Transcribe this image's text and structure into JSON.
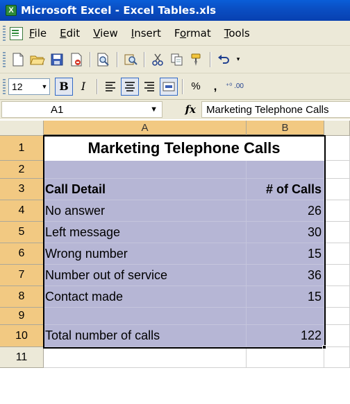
{
  "window": {
    "title": "Microsoft Excel - Excel Tables.xls"
  },
  "menu": [
    {
      "pre": "",
      "ul": "F",
      "post": "ile"
    },
    {
      "pre": "",
      "ul": "E",
      "post": "dit"
    },
    {
      "pre": "",
      "ul": "V",
      "post": "iew"
    },
    {
      "pre": "",
      "ul": "I",
      "post": "nsert"
    },
    {
      "pre": "F",
      "ul": "o",
      "post": "rmat"
    },
    {
      "pre": "",
      "ul": "T",
      "post": "ools"
    }
  ],
  "toolbar": {
    "icons": [
      "new-icon",
      "open-icon",
      "save-icon",
      "permission-icon",
      "print-preview-icon",
      "research-icon",
      "cut-icon",
      "copy-icon",
      "format-painter-icon",
      "undo-icon"
    ]
  },
  "formatting": {
    "font_size": "12",
    "bold": "B",
    "italic": "I",
    "percent": "%",
    "comma": ",",
    "increase_decimal": "⁺⁰ .00"
  },
  "formula_bar": {
    "name_box": "A1",
    "fx": "fx",
    "content": "Marketing Telephone Calls"
  },
  "sheet": {
    "columns": [
      "A",
      "B"
    ],
    "rows": [
      "1",
      "2",
      "3",
      "4",
      "5",
      "6",
      "7",
      "8",
      "9",
      "10",
      "11"
    ],
    "title": "Marketing Telephone Calls",
    "header": {
      "detail": "Call Detail",
      "calls": "# of Calls"
    },
    "data": [
      {
        "detail": "No answer",
        "calls": "26"
      },
      {
        "detail": "Left message",
        "calls": "30"
      },
      {
        "detail": "Wrong number",
        "calls": "15"
      },
      {
        "detail": "Number out of service",
        "calls": "36"
      },
      {
        "detail": "Contact made",
        "calls": "15"
      }
    ],
    "total": {
      "detail": "Total number of calls",
      "calls": "122"
    }
  },
  "colors": {
    "selection": "#b6b6d5",
    "header_highlight": "#f2c982",
    "titlebar": "#0a5ed8"
  }
}
